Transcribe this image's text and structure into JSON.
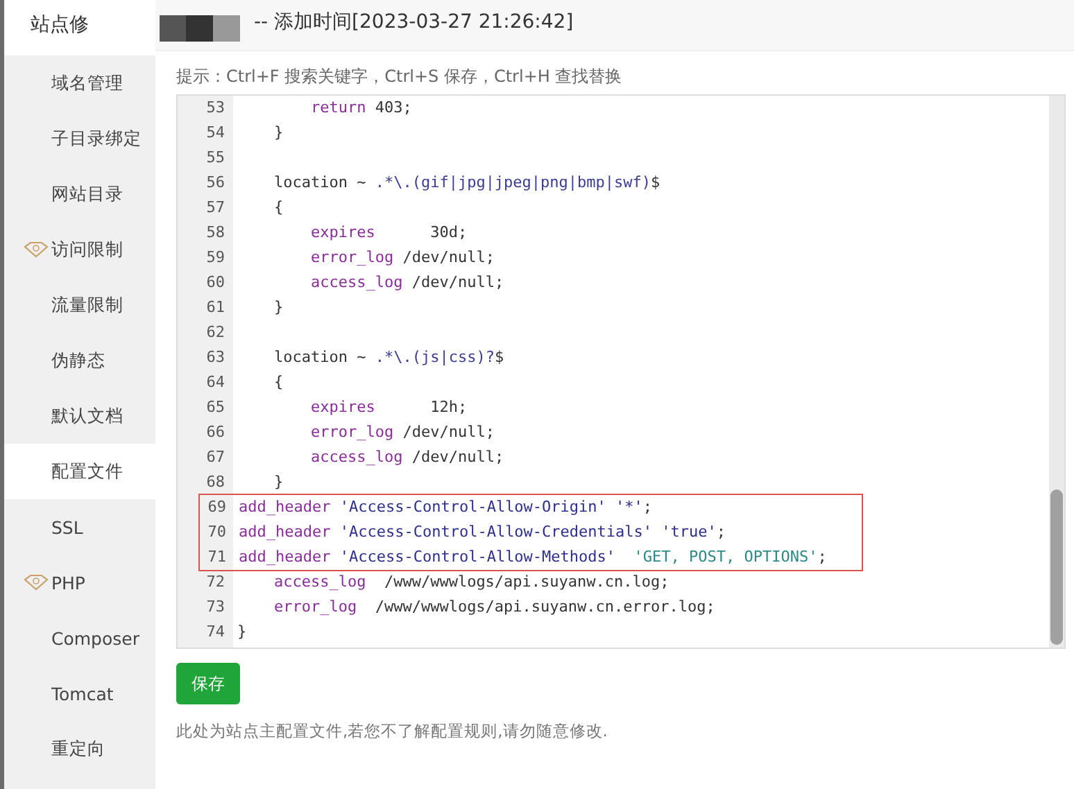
{
  "sidebar": {
    "title": "站点修",
    "items": [
      {
        "label": "域名管理",
        "selected": false,
        "premium": false
      },
      {
        "label": "子目录绑定",
        "selected": false,
        "premium": false
      },
      {
        "label": "网站目录",
        "selected": false,
        "premium": false
      },
      {
        "label": "访问限制",
        "selected": false,
        "premium": true
      },
      {
        "label": "流量限制",
        "selected": false,
        "premium": false
      },
      {
        "label": "伪静态",
        "selected": false,
        "premium": false
      },
      {
        "label": "默认文档",
        "selected": false,
        "premium": false
      },
      {
        "label": "配置文件",
        "selected": true,
        "premium": false
      },
      {
        "label": "SSL",
        "selected": false,
        "premium": false
      },
      {
        "label": "PHP",
        "selected": false,
        "premium": true
      },
      {
        "label": "Composer",
        "selected": false,
        "premium": false
      },
      {
        "label": "Tomcat",
        "selected": false,
        "premium": false
      },
      {
        "label": "重定向",
        "selected": false,
        "premium": false
      }
    ]
  },
  "header": {
    "title": "-- 添加时间[2023-03-27 21:26:42]"
  },
  "hint": "提示：Ctrl+F 搜索关键字，Ctrl+S 保存，Ctrl+H 查找替换",
  "editor": {
    "lines": [
      {
        "number": "53",
        "highlighted": false,
        "code": [
          {
            "t": "        return",
            "kind": "keyword"
          },
          {
            "t": " 403;",
            "kind": "plain"
          }
        ]
      },
      {
        "number": "54",
        "highlighted": false,
        "code": [
          {
            "t": "    }",
            "kind": "plain"
          }
        ]
      },
      {
        "number": "55",
        "highlighted": false
      },
      {
        "number": "56",
        "highlighted": false,
        "code": [
          {
            "t": "    location ~ ",
            "kind": "plain"
          },
          {
            "t": ".*\\.(gif|jpg|jpeg|png|bmp|swf)",
            "kind": "regex"
          },
          {
            "t": "$",
            "kind": "plain"
          }
        ]
      },
      {
        "number": "57",
        "highlighted": false,
        "code": [
          {
            "t": "    {",
            "kind": "plain"
          }
        ]
      },
      {
        "number": "58",
        "highlighted": false,
        "code": [
          {
            "t": "        expires",
            "kind": "keyword"
          },
          {
            "t": "      30d;",
            "kind": "plain"
          }
        ]
      },
      {
        "number": "59",
        "highlighted": false,
        "code": [
          {
            "t": "        error_log",
            "kind": "keyword"
          },
          {
            "t": " /dev/null;",
            "kind": "plain"
          }
        ]
      },
      {
        "number": "60",
        "highlighted": false,
        "code": [
          {
            "t": "        access_log",
            "kind": "keyword"
          },
          {
            "t": " /dev/null;",
            "kind": "plain"
          }
        ]
      },
      {
        "number": "61",
        "highlighted": false,
        "code": [
          {
            "t": "    }",
            "kind": "plain"
          }
        ]
      },
      {
        "number": "62",
        "highlighted": false
      },
      {
        "number": "63",
        "highlighted": false,
        "code": [
          {
            "t": "    location ~ ",
            "kind": "plain"
          },
          {
            "t": ".*\\.(js|css)?",
            "kind": "regex"
          },
          {
            "t": "$",
            "kind": "plain"
          }
        ]
      },
      {
        "number": "64",
        "highlighted": false,
        "code": [
          {
            "t": "    {",
            "kind": "plain"
          }
        ]
      },
      {
        "number": "65",
        "highlighted": false,
        "code": [
          {
            "t": "        expires",
            "kind": "keyword"
          },
          {
            "t": "      12h;",
            "kind": "plain"
          }
        ]
      },
      {
        "number": "66",
        "highlighted": false,
        "code": [
          {
            "t": "        error_log",
            "kind": "keyword"
          },
          {
            "t": " /dev/null;",
            "kind": "plain"
          }
        ]
      },
      {
        "number": "67",
        "highlighted": false,
        "code": [
          {
            "t": "        access_log",
            "kind": "keyword"
          },
          {
            "t": " /dev/null;",
            "kind": "plain"
          }
        ]
      },
      {
        "number": "68",
        "highlighted": false,
        "code": [
          {
            "t": "    }",
            "kind": "plain"
          }
        ]
      },
      {
        "number": "69",
        "highlighted": true,
        "code": [
          {
            "t": "add_header",
            "kind": "keyword"
          },
          {
            "t": " 'Access-Control-Allow-Origin'",
            "kind": "string"
          },
          {
            "t": " '*'",
            "kind": "string"
          },
          {
            "t": ";",
            "kind": "plain"
          }
        ]
      },
      {
        "number": "70",
        "highlighted": true,
        "code": [
          {
            "t": "add_header",
            "kind": "keyword"
          },
          {
            "t": " 'Access-Control-Allow-Credentials'",
            "kind": "string"
          },
          {
            "t": " 'true'",
            "kind": "string"
          },
          {
            "t": ";",
            "kind": "plain"
          }
        ]
      },
      {
        "number": "71",
        "highlighted": true,
        "code": [
          {
            "t": "add_header",
            "kind": "keyword"
          },
          {
            "t": " 'Access-Control-Allow-Methods'",
            "kind": "string"
          },
          {
            "t": "  'GET, POST, OPTIONS'",
            "kind": "value"
          },
          {
            "t": ";",
            "kind": "plain"
          }
        ]
      },
      {
        "number": "72",
        "highlighted": false,
        "code": [
          {
            "t": "    access_log",
            "kind": "keyword"
          },
          {
            "t": "  /www/wwwlogs/api.suyanw.cn.log;",
            "kind": "plain"
          }
        ]
      },
      {
        "number": "73",
        "highlighted": false,
        "code": [
          {
            "t": "    error_log",
            "kind": "keyword"
          },
          {
            "t": "  /www/wwwlogs/api.suyanw.cn.error.log;",
            "kind": "plain"
          }
        ]
      },
      {
        "number": "74",
        "highlighted": false,
        "code": [
          {
            "t": "}",
            "kind": "plain"
          }
        ]
      }
    ]
  },
  "save_button": "保存",
  "note": "此处为站点主配置文件,若您不了解配置规则,请勿随意修改."
}
